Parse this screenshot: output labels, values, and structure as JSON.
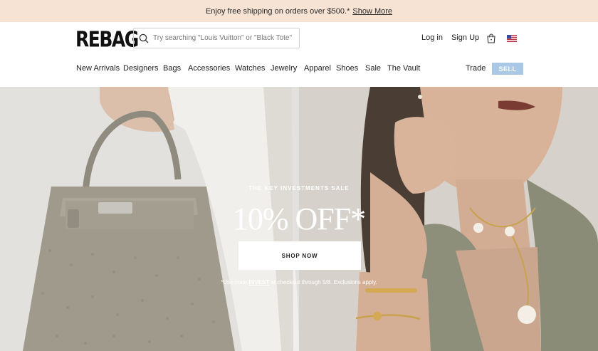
{
  "promo": {
    "text": "Enjoy free shipping on orders over $500.*",
    "link": "Show More"
  },
  "header": {
    "logo": "REBAG",
    "search_placeholder": "Try searching \"Louis Vuitton\" or \"Black Tote\"",
    "login": "Log in",
    "signup": "Sign Up",
    "cart_icon": "shopping-bag-icon",
    "flag_icon": "us-flag-icon"
  },
  "nav": {
    "items": [
      "New Arrivals",
      "Designers",
      "Bags",
      "Accessories",
      "Watches",
      "Jewelry",
      "Apparel",
      "Shoes",
      "Sale",
      "The Vault"
    ],
    "trade": "Trade",
    "sell": "SELL"
  },
  "hero": {
    "eyebrow": "THE KEY INVESTMENTS SALE",
    "headline": "10% OFF*",
    "cta": "SHOP NOW",
    "fine_prefix": "*Use code ",
    "code": "INVEST",
    "fine_suffix": " at checkout through 5/8. Exclusions apply."
  },
  "colors": {
    "promo_bg": "#f7e3d4",
    "sell_bg": "#a8c8e6"
  }
}
